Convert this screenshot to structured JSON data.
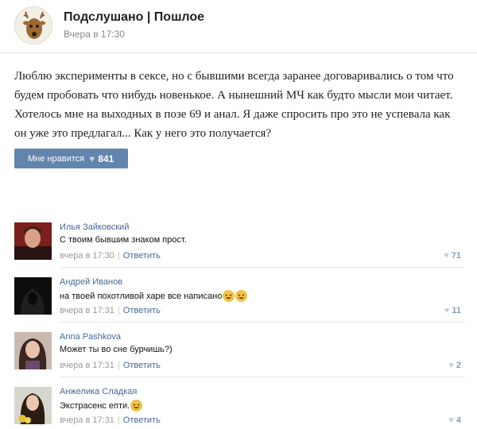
{
  "post": {
    "group_name": "Подслушано | Пошлое",
    "date": "Вчера в 17:30",
    "text": "Люблю эксперименты в сексе, но с бывшими всегда заранее договаривались о том что будем пробовать что нибудь новенькое. А нынешний МЧ как будто мысли мои читает. Хотелось мне на выходных в позе 69 и анал. Я даже спросить про это не успевала как он уже это предлагал... Как у него это получается?",
    "like_label": "Мне нравится",
    "like_count": "841"
  },
  "comments": [
    {
      "author": "Илья Зайковский",
      "text": "С твоим бывшим знаком прост.",
      "time": "вчера в 17:30",
      "reply": "Ответить",
      "likes": "71",
      "emoji_count": 0
    },
    {
      "author": "Андрей Иванов",
      "text": "на твоей похотливой харе все написано",
      "time": "вчера в 17:31",
      "reply": "Ответить",
      "likes": "11",
      "emoji_count": 2
    },
    {
      "author": "Anna Pashkova",
      "text": "Может ты во сне бурчишь?)",
      "time": "вчера в 17:31",
      "reply": "Ответить",
      "likes": "2",
      "emoji_count": 0
    },
    {
      "author": "Анжелика Сладкая",
      "text": "Экстрасенс епти.",
      "time": "вчера в 17:31",
      "reply": "Ответить",
      "likes": "4",
      "emoji_count": 1
    }
  ],
  "colors": {
    "accent": "#6285ad",
    "link": "#46699a",
    "muted": "#999999"
  },
  "icons": {
    "like": "heart-icon",
    "emoji": "laughing-emoji-icon"
  }
}
